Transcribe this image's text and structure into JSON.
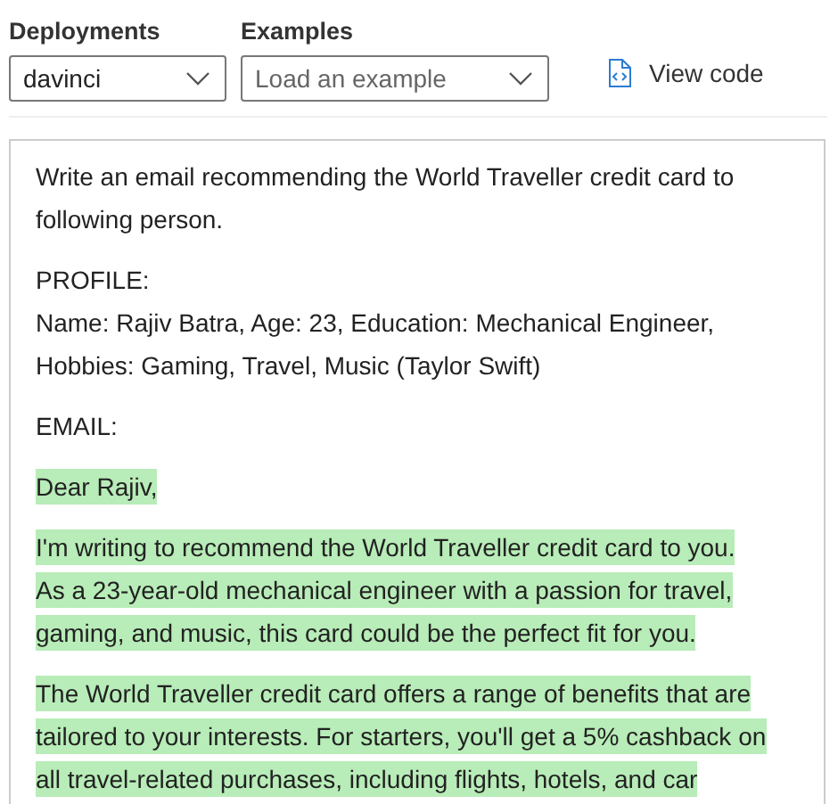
{
  "toolbar": {
    "deployment": {
      "label": "Deployments",
      "value": "davinci"
    },
    "examples": {
      "label": "Examples",
      "placeholder": "Load an example"
    },
    "view_code": "View code"
  },
  "paragraphs": [
    {
      "highlighted": false,
      "lines": [
        "Write an email recommending the World Traveller credit card to",
        "following person."
      ]
    },
    {
      "highlighted": false,
      "lines": [
        "PROFILE:",
        "Name: Rajiv Batra, Age: 23, Education: Mechanical Engineer,",
        "Hobbies: Gaming, Travel, Music (Taylor Swift)"
      ]
    },
    {
      "highlighted": false,
      "lines": [
        "EMAIL:"
      ]
    },
    {
      "highlighted": true,
      "lines": [
        "Dear Rajiv,"
      ]
    },
    {
      "highlighted": true,
      "lines": [
        "I'm writing to recommend the World Traveller credit card to you.",
        "As a 23-year-old mechanical engineer with a passion for travel,",
        "gaming, and music, this card could be the perfect fit for you."
      ]
    },
    {
      "highlighted": true,
      "lines": [
        "The World Traveller credit card offers a range of benefits that are",
        "tailored to your interests. For starters, you'll get a 5% cashback on",
        "all travel-related purchases, including flights, hotels, and car"
      ]
    }
  ]
}
